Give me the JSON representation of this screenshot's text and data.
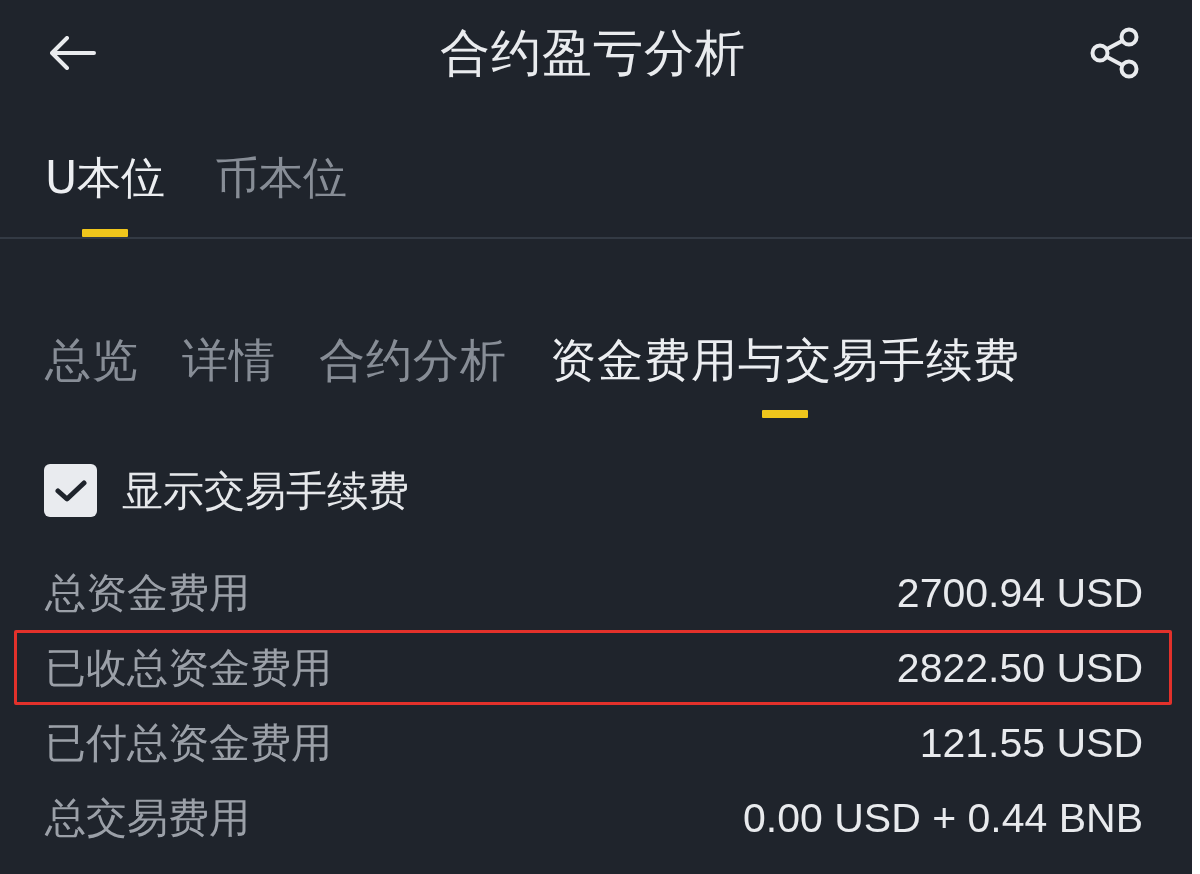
{
  "header": {
    "title": "合约盈亏分析"
  },
  "margin_tabs": [
    {
      "label": "U本位",
      "selected": true
    },
    {
      "label": "币本位",
      "selected": false
    }
  ],
  "section_tabs": [
    {
      "label": "总览",
      "selected": false
    },
    {
      "label": "详情",
      "selected": false
    },
    {
      "label": "合约分析",
      "selected": false
    },
    {
      "label": "资金费用与交易手续费",
      "selected": true
    }
  ],
  "show_fees_option": {
    "label": "显示交易手续费",
    "checked": true
  },
  "fee_rows": [
    {
      "label": "总资金费用",
      "value": "2700.94 USD",
      "highlighted": false
    },
    {
      "label": "已收总资金费用",
      "value": "2822.50 USD",
      "highlighted": true
    },
    {
      "label": "已付总资金费用",
      "value": "121.55 USD",
      "highlighted": false
    },
    {
      "label": "总交易费用",
      "value": "0.00 USD + 0.44 BNB",
      "highlighted": false
    }
  ]
}
